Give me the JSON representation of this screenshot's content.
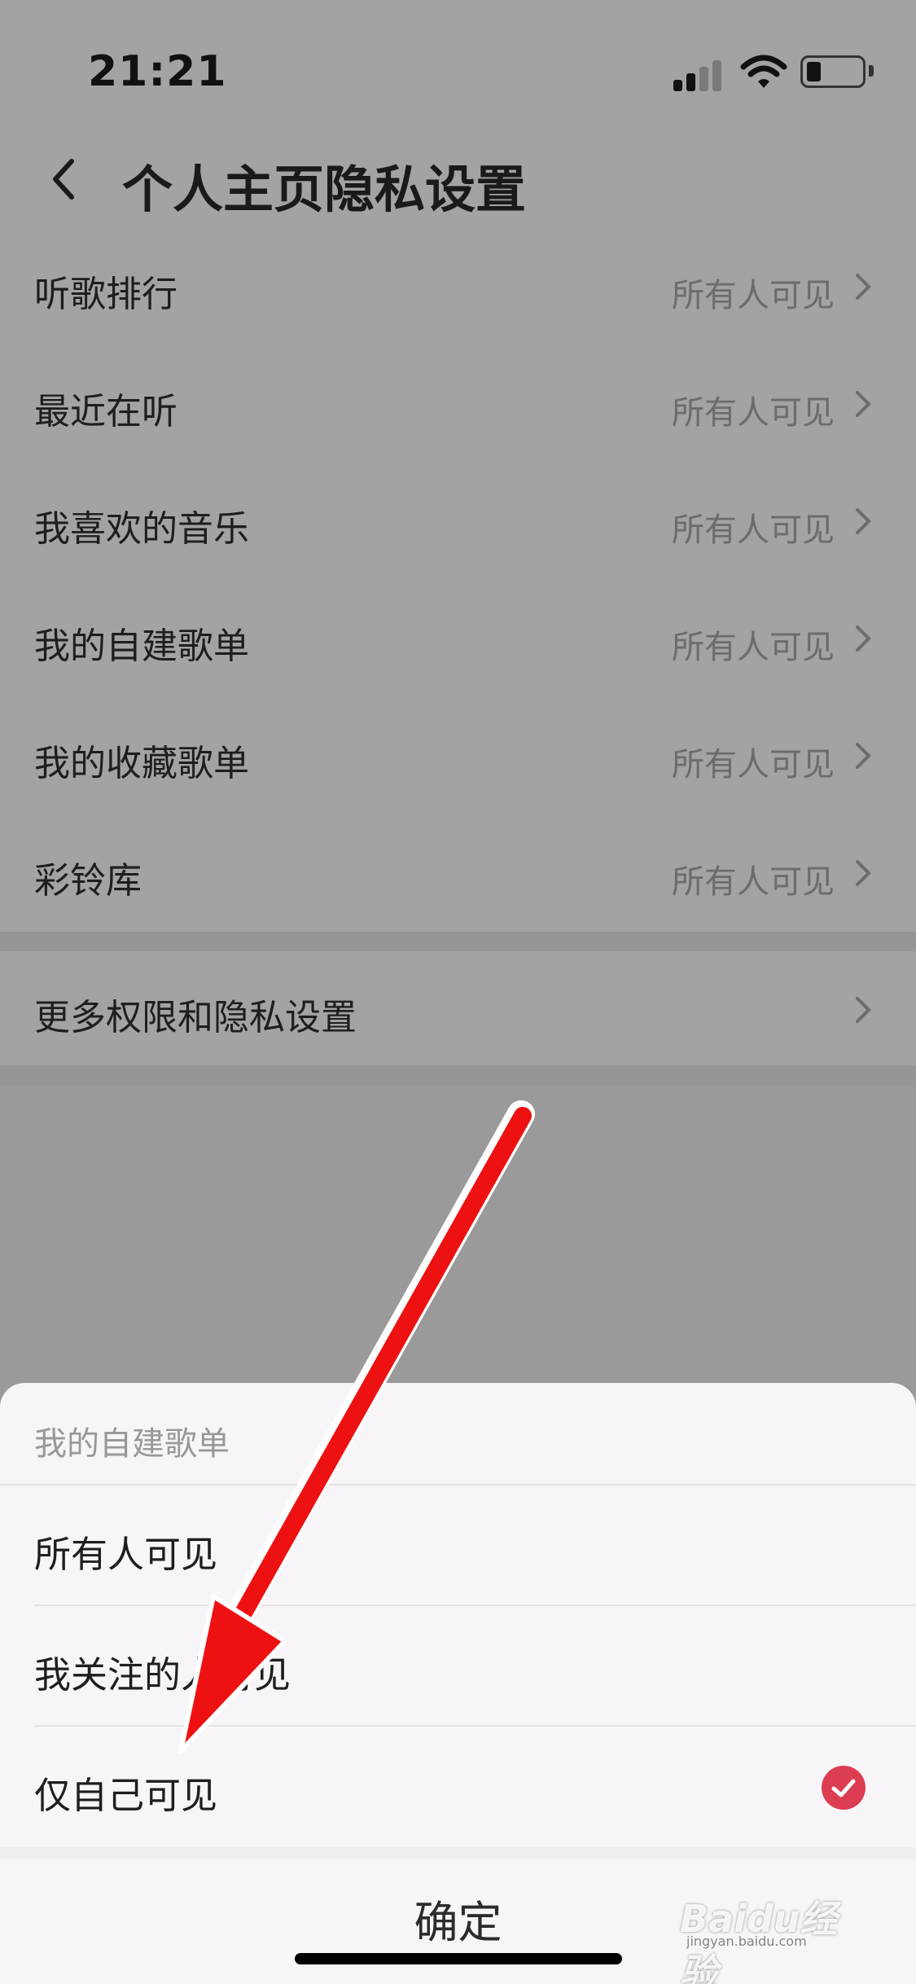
{
  "status_bar": {
    "time": "21:21"
  },
  "header": {
    "title": "个人主页隐私设置"
  },
  "settings": [
    {
      "label": "听歌排行",
      "value": "所有人可见"
    },
    {
      "label": "最近在听",
      "value": "所有人可见"
    },
    {
      "label": "我喜欢的音乐",
      "value": "所有人可见"
    },
    {
      "label": "我的自建歌单",
      "value": "所有人可见"
    },
    {
      "label": "我的收藏歌单",
      "value": "所有人可见"
    },
    {
      "label": "彩铃库",
      "value": "所有人可见"
    }
  ],
  "more_settings": {
    "label": "更多权限和隐私设置"
  },
  "sheet": {
    "title": "我的自建歌单",
    "options": [
      {
        "label": "所有人可见",
        "selected": false
      },
      {
        "label": "我关注的人可见",
        "selected": false
      },
      {
        "label": "仅自己可见",
        "selected": true
      }
    ],
    "confirm": "确定"
  },
  "colors": {
    "accent": "#dd3d52",
    "annotation_arrow": "#ee1111"
  },
  "icons": {
    "back": "chevron-left-icon",
    "row": "chevron-right-icon",
    "selected": "check-circle-icon"
  },
  "watermark": {
    "text": "Baidu经验",
    "sub": "jingyan.baidu.com"
  }
}
